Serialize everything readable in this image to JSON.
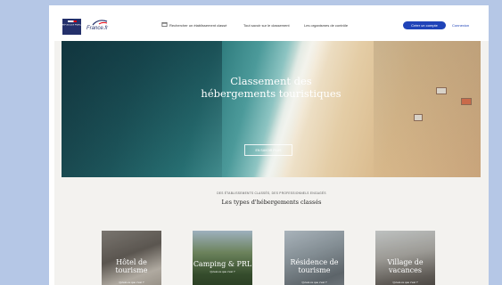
{
  "nav": {
    "logo_rf_text": "RÉPUBLIQUE FRANÇAISE",
    "logo_france_text": "France.fr",
    "search_label": "Rechercher un établissement classé",
    "about_label": "Tout savoir sur le classement",
    "orgs_label": "Les organismes de contrôle",
    "create_account_label": "Créer un compte",
    "login_label": "Connexion"
  },
  "hero": {
    "title_line1": "Classement des",
    "title_line2": "hébergements touristiques",
    "button_label": "EN SAVOIR PLUS"
  },
  "section": {
    "kicker": "DES ÉTABLISSEMENTS CLASSÉS, DES PROFESSIONNELS ENGAGÉS",
    "title": "Les types d'hébergements classés"
  },
  "cards": [
    {
      "title_line1": "Hôtel de",
      "title_line2": "tourisme",
      "link": "Qu'est-ce que c'est ?"
    },
    {
      "title_line1": "Camping & PRL",
      "title_line2": "",
      "link": "Qu'est-ce que c'est ?"
    },
    {
      "title_line1": "Résidence de",
      "title_line2": "tourisme",
      "link": "Qu'est-ce que c'est ?"
    },
    {
      "title_line1": "Village de",
      "title_line2": "vacances",
      "link": "Qu'est-ce que c'est ?"
    }
  ],
  "colors": {
    "page_bg": "#b5c7e6",
    "primary": "#1f43b8",
    "navy": "#24306b"
  }
}
